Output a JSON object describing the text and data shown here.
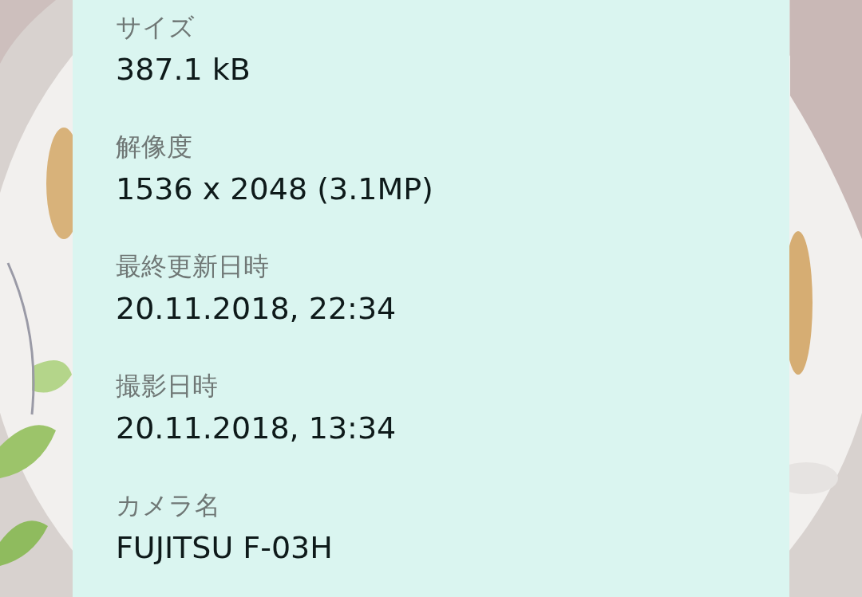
{
  "details": [
    {
      "label": "サイズ",
      "value": "387.1 kB"
    },
    {
      "label": "解像度",
      "value": "1536 x 2048 (3.1MP)"
    },
    {
      "label": "最終更新日時",
      "value": "20.11.2018, 22:34"
    },
    {
      "label": "撮影日時",
      "value": "20.11.2018, 13:34"
    },
    {
      "label": "カメラ名",
      "value": "FUJITSU F-03H"
    }
  ]
}
